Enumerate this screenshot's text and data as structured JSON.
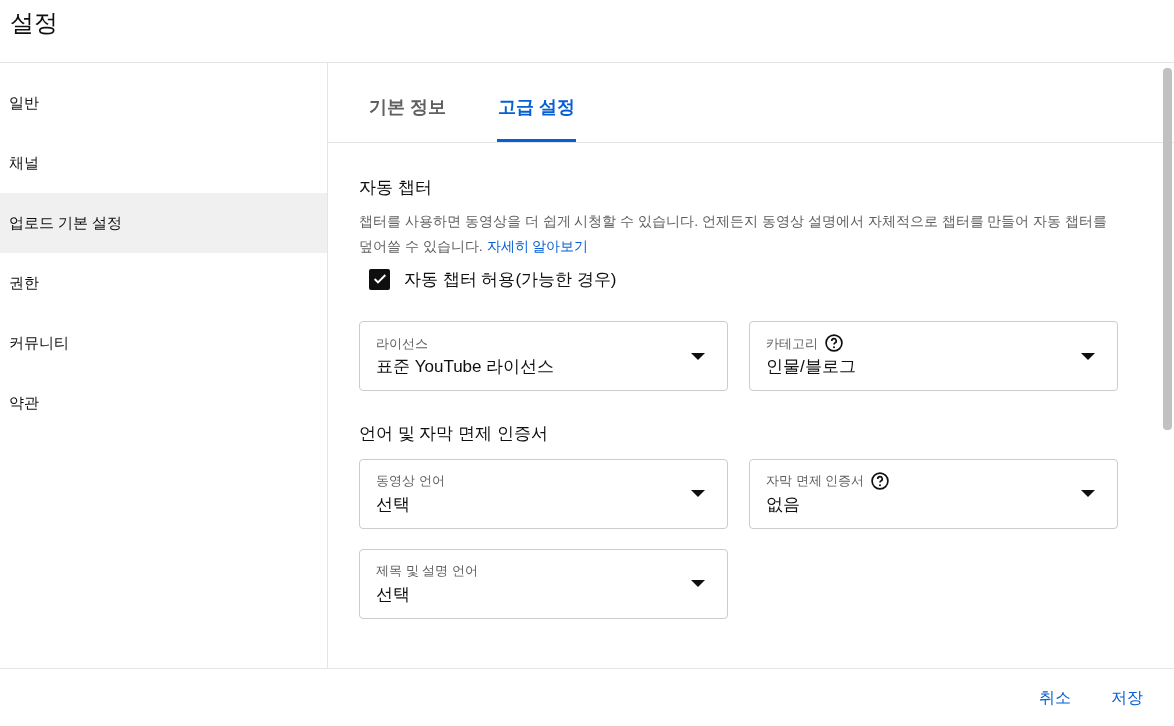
{
  "window": {
    "title": "설정"
  },
  "sidebar": {
    "items": [
      {
        "label": "일반",
        "selected": false
      },
      {
        "label": "채널",
        "selected": false
      },
      {
        "label": "업로드 기본 설정",
        "selected": true
      },
      {
        "label": "권한",
        "selected": false
      },
      {
        "label": "커뮤니티",
        "selected": false
      },
      {
        "label": "약관",
        "selected": false
      }
    ]
  },
  "tabs": [
    {
      "label": "기본 정보",
      "selected": false
    },
    {
      "label": "고급 설정",
      "selected": true
    }
  ],
  "auto_chapters": {
    "heading": "자동 챕터",
    "description": "챕터를 사용하면 동영상을 더 쉽게 시청할 수 있습니다. 언제든지 동영상 설명에서 자체적으로 챕터를 만들어 자동 챕터를 덮어쓸 수 있습니다.",
    "link": "자세히 알아보기",
    "checkbox": {
      "label": "자동 챕터 허용(가능한 경우)",
      "checked": true
    }
  },
  "dropdowns_top": [
    {
      "label": "라이선스",
      "value": "표준 YouTube 라이선스",
      "help": false
    },
    {
      "label": "카테고리",
      "value": "인물/블로그",
      "help": true
    }
  ],
  "language_section": {
    "heading": "언어 및 자막 면제 인증서",
    "dropdowns": [
      {
        "label": "동영상 언어",
        "value": "선택",
        "help": false
      },
      {
        "label": "자막 면제 인증서",
        "value": "없음",
        "help": true
      },
      {
        "label": "제목 및 설명 언어",
        "value": "선택",
        "help": false
      }
    ]
  },
  "footer": {
    "buttons": [
      "취소",
      "저장"
    ]
  }
}
